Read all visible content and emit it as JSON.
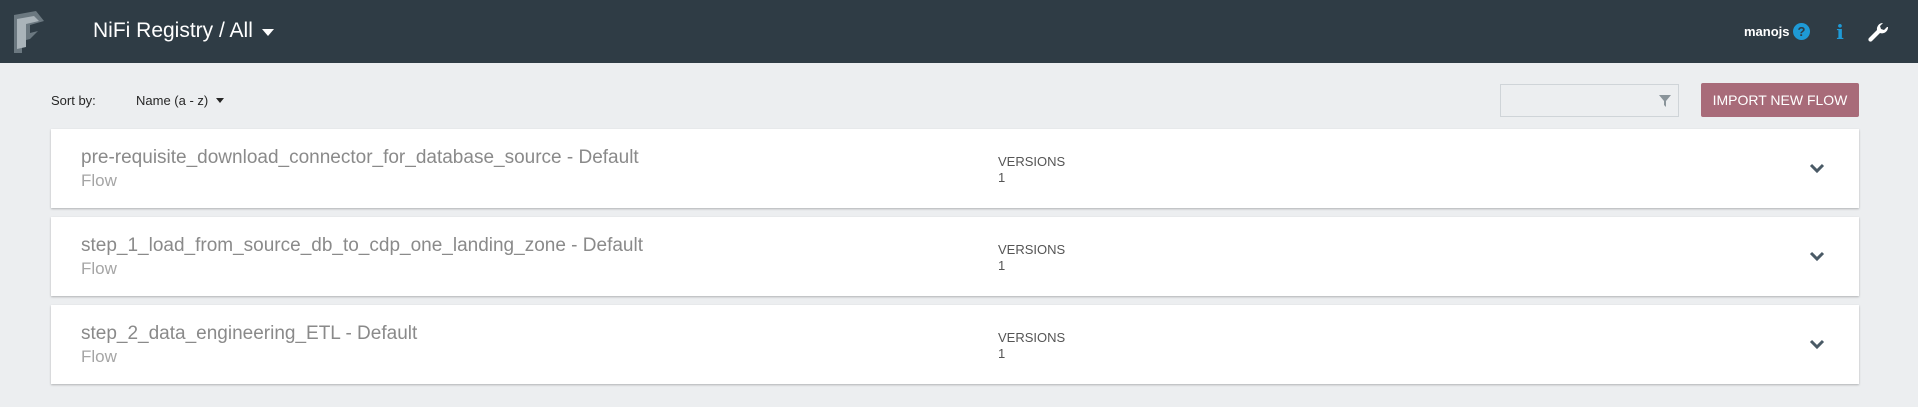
{
  "header": {
    "title": "NiFi Registry / All",
    "user": "manojs",
    "logo_icon": "nifi-registry-logo-icon",
    "icons": [
      "help-icon",
      "info-icon",
      "wrench-icon"
    ],
    "background": "#2f3c45",
    "accent": "#1e9ad6"
  },
  "toolbar": {
    "sort_label": "Sort by:",
    "sort_value": "Name (a - z)",
    "filter_placeholder": "",
    "import_label": "IMPORT NEW FLOW",
    "import_color": "#a86b79"
  },
  "flows": [
    {
      "name": "pre-requisite_download_connector_for_database_source - Default",
      "type": "Flow",
      "versions_label": "VERSIONS",
      "versions": "1"
    },
    {
      "name": "step_1_load_from_source_db_to_cdp_one_landing_zone - Default",
      "type": "Flow",
      "versions_label": "VERSIONS",
      "versions": "1"
    },
    {
      "name": "step_2_data_engineering_ETL - Default",
      "type": "Flow",
      "versions_label": "VERSIONS",
      "versions": "1"
    }
  ]
}
